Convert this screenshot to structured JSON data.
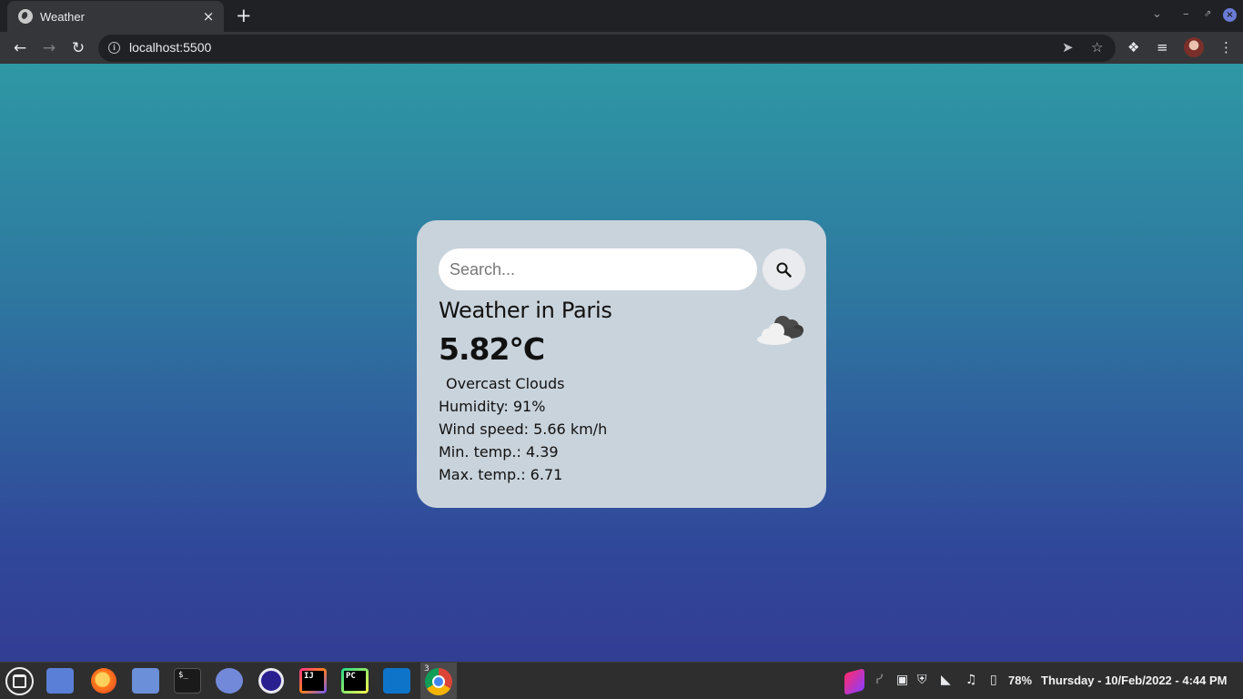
{
  "browser": {
    "tab_title": "Weather",
    "url": "localhost:5500",
    "new_tab_label": "+",
    "tab_close_label": "×"
  },
  "weather": {
    "search": {
      "placeholder": "Search..."
    },
    "city_title": "Weather in Paris",
    "temperature": "5.82°C",
    "description": "Overcast Clouds",
    "humidity": "Humidity: 91%",
    "wind": "Wind speed: 5.66 km/h",
    "min_temp": "Min. temp.: 4.39",
    "max_temp": "Max. temp.: 6.71",
    "icon": "overcast-clouds-icon"
  },
  "taskbar": {
    "chrome_badge": "3",
    "battery": "78%",
    "datetime": "Thursday - 10/Feb/2022 -  4:44 PM",
    "terminal_glyph": "$_",
    "intellij_glyph": "IJ",
    "pycharm_glyph": "PC"
  },
  "colors": {
    "page_gradient_top": "#2e98a4",
    "page_gradient_bottom": "#323d94",
    "card_background": "#c9d3dc"
  }
}
